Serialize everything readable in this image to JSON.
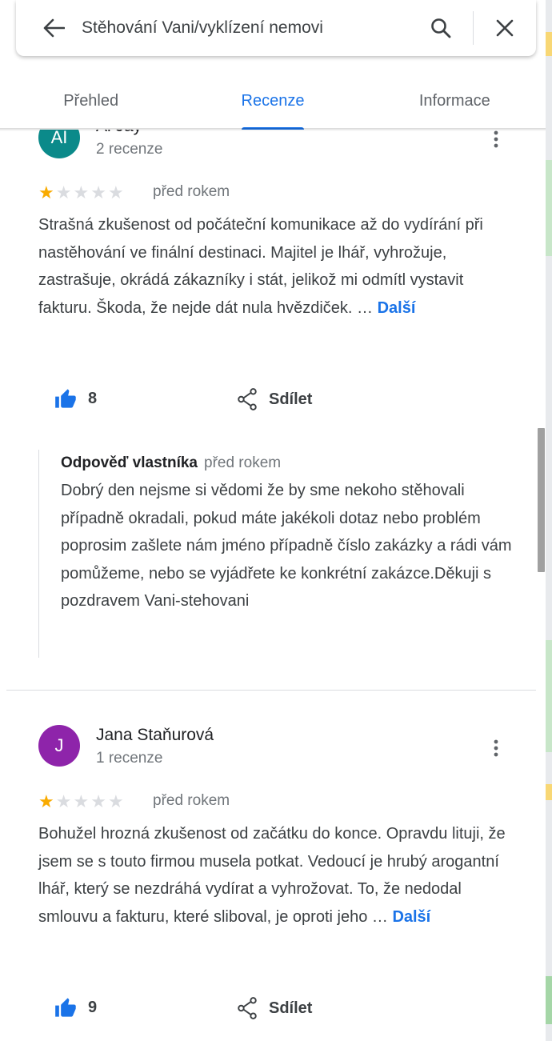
{
  "search": {
    "query": "Stěhování Vani/vyklízení nemovi"
  },
  "tabs": [
    {
      "label": "Přehled"
    },
    {
      "label": "Recenze",
      "active": true
    },
    {
      "label": "Informace"
    }
  ],
  "reviews": [
    {
      "avatar_initials": "AI",
      "avatar_color": "#0b8a8a",
      "author": "Al Jay",
      "review_count": "2 recenze",
      "rating": 1,
      "max_rating": 5,
      "date": "před rokem",
      "text": "Strašná zkušenost od počáteční komunikace až do vydírání při nastěhování ve finální destinaci. Majitel je lhář, vyhrožuje, zastrašuje, okrádá zákazníky i stát, jelikož mi odmítl vystavit fakturu. Škoda, že nejde dát nula hvězdiček. …",
      "more_label": "Další",
      "likes": "8",
      "share_label": "Sdílet",
      "owner_reply": {
        "label": "Odpověď vlastníka",
        "date": "před rokem",
        "text": "Dobrý den nejsme si vědomi že by sme nekoho stěhovali případně okradali, pokud máte jakékoli dotaz nebo problém poprosim zašlete nám jméno případně číslo zakázky a rádi vám pomůžeme, nebo se vyjádřete ke konkrétní zakázce.Děkuji s pozdravem Vani-stehovani"
      }
    },
    {
      "avatar_initials": "J",
      "avatar_color": "#8e24aa",
      "author": "Jana Staňurová",
      "review_count": "1 recenze",
      "rating": 1,
      "max_rating": 5,
      "date": "před rokem",
      "text": "Bohužel hrozná zkušenost od začátku do konce. Opravdu lituji, že jsem se s touto firmou musela potkat. Vedoucí je hrubý arogantní lhář, který se nezdráhá vydírat a vyhrožovat. To, že nedodal smlouvu a fakturu, které sliboval, je oproti jeho …",
      "more_label": "Další",
      "likes": "9",
      "share_label": "Sdílet"
    }
  ],
  "colors": {
    "accent": "#1a73e8",
    "star": "#f9ab00"
  }
}
